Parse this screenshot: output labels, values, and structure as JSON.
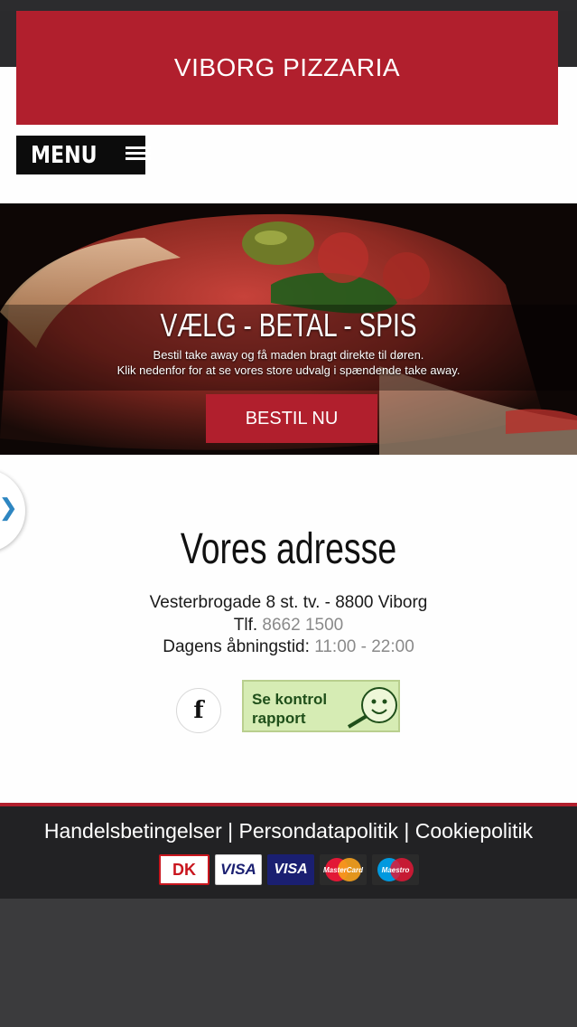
{
  "brand": {
    "title": "VIBORG PIZZARIA"
  },
  "menu": {
    "label": "MENU",
    "icon": "hamburger-icon"
  },
  "hero": {
    "headline": "VÆLG - BETAL - SPIS",
    "subline1": "Bestil take away og få maden bragt direkte til døren.",
    "subline2": "Klik nedenfor for at se vores store udvalg i spændende take away.",
    "button_label": "BESTIL NU"
  },
  "side_tab": {
    "icon": "chevron-right-icon",
    "glyph": "❯"
  },
  "address": {
    "title": "Vores adresse",
    "street": "Vesterbrogade 8 st. tv. - 8800 Viborg",
    "phone_label": "Tlf.",
    "phone": "8662 1500",
    "hours_label": "Dagens åbningstid:",
    "hours": "11:00 - 22:00"
  },
  "social": {
    "facebook_glyph": "f"
  },
  "kontrol": {
    "line1": "Se kontrol",
    "line2": "rapport"
  },
  "footer": {
    "links": [
      "Handelsbetingelser",
      "Persondatapolitik",
      "Cookiepolitik"
    ],
    "separator": "|",
    "cards": [
      "DK",
      "VISA",
      "VISA",
      "MasterCard",
      "Maestro"
    ]
  },
  "colors": {
    "brand_red": "#b11f2d",
    "footer_bg": "#222224",
    "muted_text": "#8a8a8a",
    "link_blue": "#2e86c1"
  }
}
